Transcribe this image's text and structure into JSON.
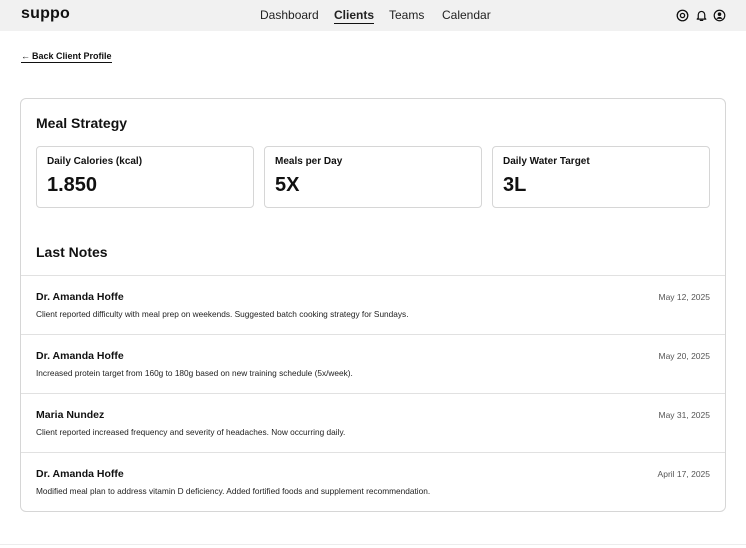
{
  "header": {
    "brand": "suppo",
    "nav": {
      "dashboard": "Dashboard",
      "clients": "Clients",
      "teams": "Teams",
      "calendar": "Calendar"
    },
    "active_nav": "Clients",
    "icons": [
      "support-icon",
      "bell-icon",
      "user-icon"
    ]
  },
  "back_link": {
    "arrow": "←",
    "label": "Back Client Profile"
  },
  "meal_strategy": {
    "title": "Meal Strategy",
    "metrics": [
      {
        "label": "Daily Calories (kcal)",
        "value": "1.850"
      },
      {
        "label": "Meals per Day",
        "value": "5X"
      },
      {
        "label": "Daily Water Target",
        "value": "3L"
      }
    ]
  },
  "notes": {
    "title": "Last Notes",
    "items": [
      {
        "author": "Dr. Amanda Hoffe",
        "date": "May 12, 2025",
        "text": "Client reported difficulty with meal prep on weekends. Suggested batch cooking strategy for Sundays."
      },
      {
        "author": "Dr. Amanda Hoffe",
        "date": "May 20, 2025",
        "text": "Increased protein target from 160g to 180g based on new training schedule (5x/week)."
      },
      {
        "author": "Maria Nundez",
        "date": "May 31, 2025",
        "text": "Client reported increased frequency and severity of headaches. Now occurring daily."
      },
      {
        "author": "Dr. Amanda Hoffe",
        "date": "April 17, 2025",
        "text": "Modified meal plan to address vitamin D deficiency. Added fortified foods and supplement recommendation."
      }
    ]
  },
  "colors": {
    "topbar_bg": "#f1f1f1",
    "border": "#d6d6d6",
    "text": "#111111"
  }
}
